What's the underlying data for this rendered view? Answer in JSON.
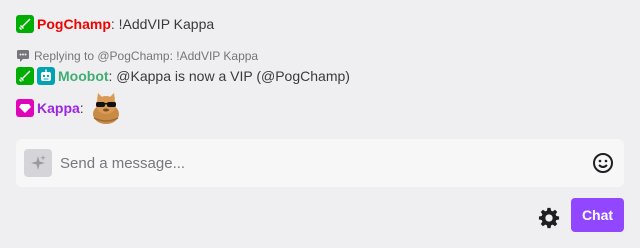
{
  "chat": {
    "line1": {
      "user": "PogChamp",
      "user_color": "#eb0400",
      "separator": ":",
      "message": " !AddVIP Kappa"
    },
    "reply_context": "Replying to @PogChamp: !AddVIP Kappa",
    "line2": {
      "user": "Moobot",
      "user_color": "#3fae72",
      "separator": ":",
      "message": " @Kappa is now a VIP (@PogChamp)"
    },
    "line3": {
      "user": "Kappa",
      "user_color": "#9b25e0",
      "separator": ":"
    }
  },
  "icons": {
    "mod_badge": "sword-icon",
    "bot_badge": "robot-icon",
    "vip_badge": "diamond-icon",
    "reply": "reply-icon",
    "emote": "sunglasses-cat-emote",
    "input_left": "sparkle-icon",
    "emoji": "smiley-icon",
    "settings": "gear-icon"
  },
  "input": {
    "placeholder": "Send a message..."
  },
  "actions": {
    "chat_button": "Chat"
  },
  "colors": {
    "accent": "#9147ff",
    "mod_green": "#00ad03",
    "bot_teal": "#00a3b4",
    "vip_pink": "#e005b9"
  }
}
